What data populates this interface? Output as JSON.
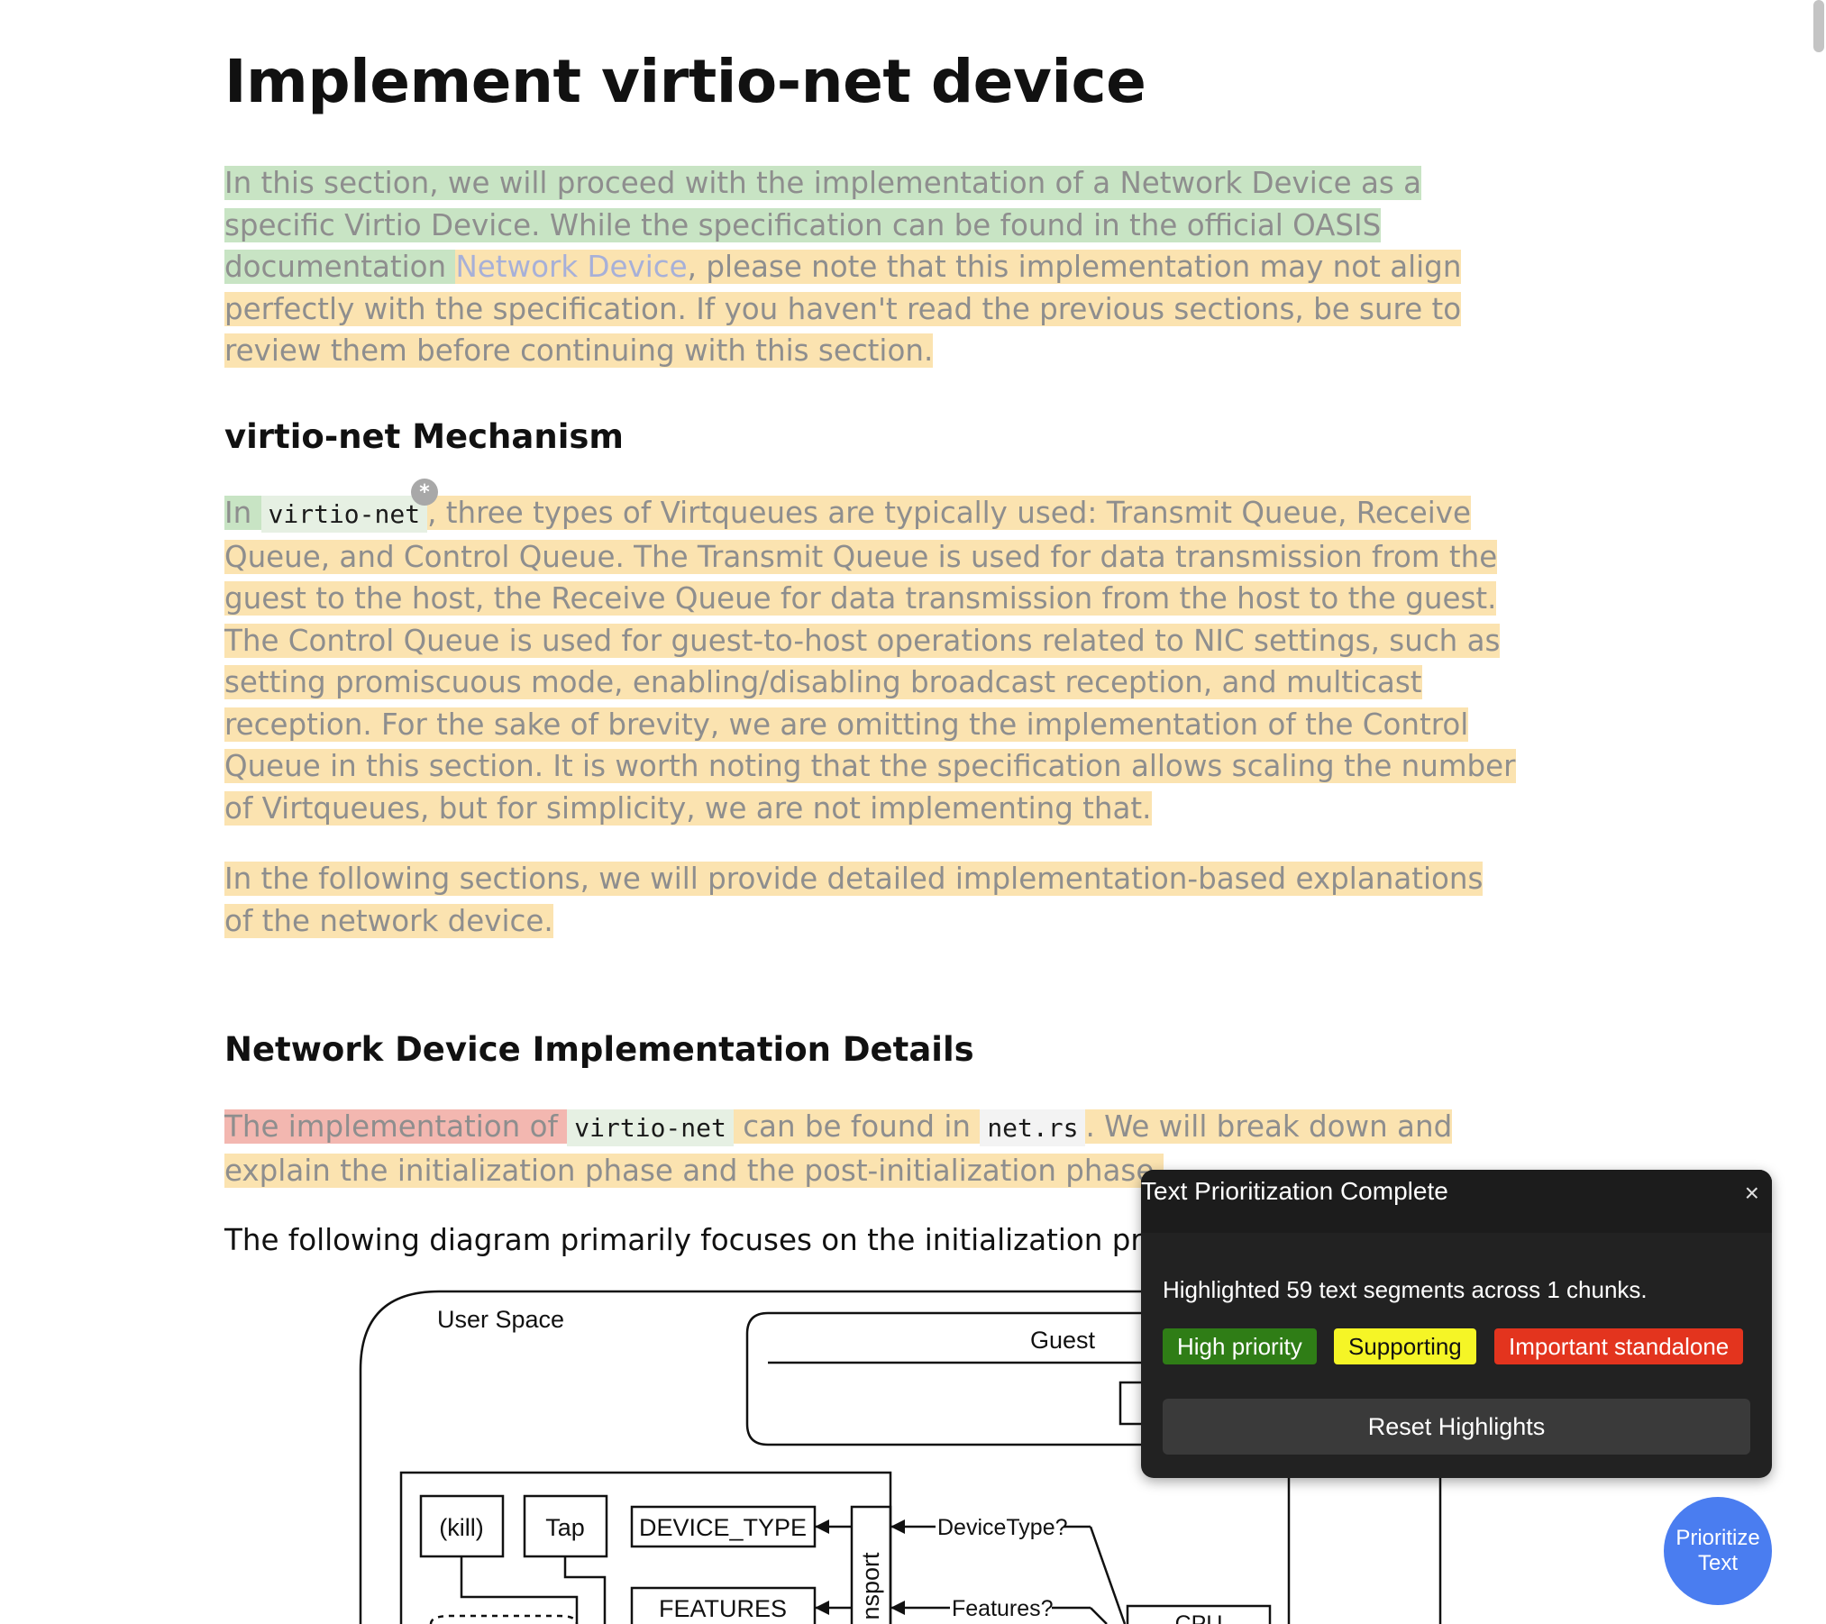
{
  "article": {
    "title": "Implement virtio-net device",
    "intro": {
      "green": "In this section, we will proceed with the implementation of a Network Device as a specific Virtio Device. While the specification can be found in the official OASIS documentation ",
      "link": "Network Device",
      "yellow": ", please note that this implementation may not align perfectly with the specification. If you haven't read the previous sections, be sure to review them before continuing with this section."
    },
    "section1": {
      "heading": "virtio-net Mechanism",
      "p1_green": "In ",
      "p1_code": "virtio-net",
      "p1_yellow": ", three types of Virtqueues are typically used: Transmit Queue, Receive Queue, and Control Queue. The Transmit Queue is used for data transmission from the guest to the host, the Receive Queue for data transmission from the host to the guest. The Control Queue is used for guest-to-host operations related to NIC settings, such as setting promiscuous mode, enabling/disabling broadcast reception, and multicast reception. For the sake of brevity, we are omitting the implementation of the Control Queue in this section. It is worth noting that the specification allows scaling the number of Virtqueues, but for simplicity, we are not implementing that.",
      "p2": "In the following sections, we will provide detailed implementation-based explanations of the network device.",
      "badge": "*"
    },
    "section2": {
      "heading": "Network Device Implementation Details",
      "p1_red": "The implementation of ",
      "p1_code1": "virtio-net",
      "p1_mid": " can be found in ",
      "p1_code2": "net.rs",
      "p1_end": ". We will break down and explain the initialization phase and the post-initialization phase.",
      "p2": "The following diagram primarily focuses on the initialization process"
    }
  },
  "diagram": {
    "user_space": "User Space",
    "guest": "Guest",
    "kill": "(kill)",
    "tap": "Tap",
    "device_type": "DEVICE_TYPE",
    "features": "FEATURES",
    "transport": "nsport",
    "device_type_q": "DeviceType?",
    "features_q": "Features?",
    "cpu": "CPU"
  },
  "popup": {
    "title": "Text Prioritization Complete",
    "close": "×",
    "summary": "Highlighted 59 text segments across 1 chunks.",
    "legend_high": "High priority",
    "legend_supporting": "Supporting",
    "legend_important": "Important standalone",
    "reset": "Reset Highlights"
  },
  "fab": {
    "line1": "Prioritize",
    "line2": "Text"
  },
  "colors": {
    "high_priority": "#2f7d16",
    "supporting": "#f5f526",
    "important_standalone": "#e3341e",
    "fab": "#4a7df0"
  }
}
